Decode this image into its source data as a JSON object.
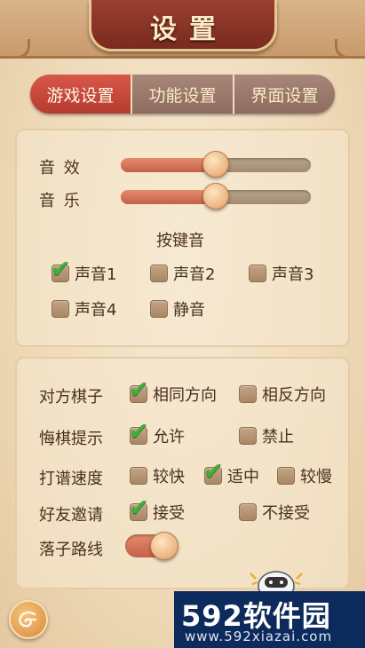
{
  "header": {
    "title": "设置"
  },
  "tabs": [
    {
      "label": "游戏设置",
      "active": true
    },
    {
      "label": "功能设置",
      "active": false
    },
    {
      "label": "界面设置",
      "active": false
    }
  ],
  "sound": {
    "effects_label": "音  效",
    "effects_level": 0.5,
    "music_label": "音  乐",
    "music_level": 0.5,
    "keytone_title": "按键音",
    "keytone_options": [
      {
        "label": "声音1",
        "checked": true
      },
      {
        "label": "声音2",
        "checked": false
      },
      {
        "label": "声音3",
        "checked": false
      },
      {
        "label": "声音4",
        "checked": false
      },
      {
        "label": "静音",
        "checked": false
      }
    ]
  },
  "board": {
    "orientation_label": "对方棋子",
    "orientation_options": [
      {
        "label": "相同方向",
        "checked": true
      },
      {
        "label": "相反方向",
        "checked": false
      }
    ],
    "undo_label": "悔棋提示",
    "undo_options": [
      {
        "label": "允许",
        "checked": true
      },
      {
        "label": "禁止",
        "checked": false
      }
    ],
    "speed_label": "打谱速度",
    "speed_options": [
      {
        "label": "较快",
        "checked": false
      },
      {
        "label": "适中",
        "checked": true
      },
      {
        "label": "较慢",
        "checked": false
      }
    ],
    "invite_label": "好友邀请",
    "invite_options": [
      {
        "label": "接受",
        "checked": true
      },
      {
        "label": "不接受",
        "checked": false
      }
    ],
    "path_label": "落子路线",
    "path_on": true
  },
  "watermark": {
    "brand": "592软件园",
    "url": "www.592xiazai.com"
  },
  "colors": {
    "accent": "#c4604a",
    "active_tab": "#c84a3c",
    "check": "#3fae3c"
  },
  "icons": {
    "back": "back-cloud-icon",
    "mascot": "mascot-icon"
  }
}
